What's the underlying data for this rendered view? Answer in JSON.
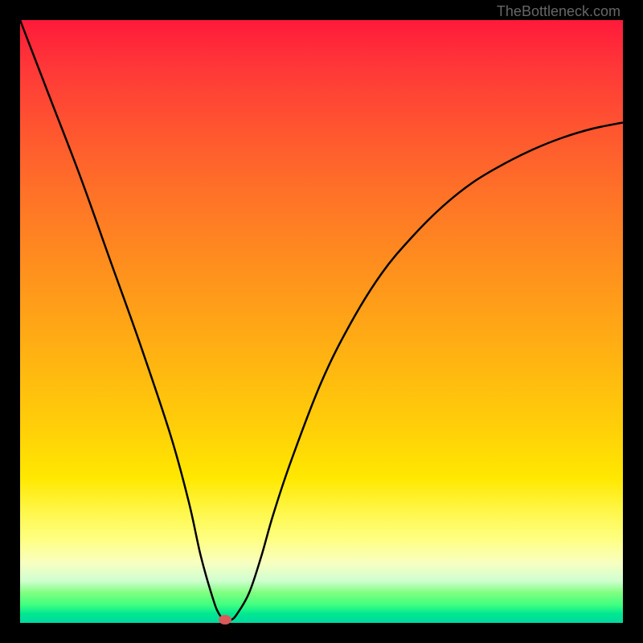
{
  "watermark": "TheBottleneck.com",
  "chart_data": {
    "type": "line",
    "title": "",
    "xlabel": "",
    "ylabel": "",
    "x_range": [
      0,
      100
    ],
    "y_range": [
      0,
      100
    ],
    "series": [
      {
        "name": "bottleneck-curve",
        "x": [
          0,
          5,
          10,
          15,
          20,
          25,
          28,
          30,
          32,
          33,
          34,
          35,
          36,
          38,
          40,
          42,
          45,
          50,
          55,
          60,
          65,
          70,
          75,
          80,
          85,
          90,
          95,
          100
        ],
        "y": [
          100,
          87,
          74,
          60,
          46,
          31,
          20,
          11,
          4,
          1.5,
          0.5,
          0.5,
          1.5,
          5,
          11,
          18,
          27,
          40,
          50,
          58,
          64,
          69,
          73,
          76,
          78.5,
          80.5,
          82,
          83
        ]
      }
    ],
    "marker": {
      "x": 34,
      "y": 0.5,
      "color": "#d85a5a"
    },
    "gradient_colors": {
      "top": "#ff1a3a",
      "bottom": "#00d8a0"
    }
  }
}
